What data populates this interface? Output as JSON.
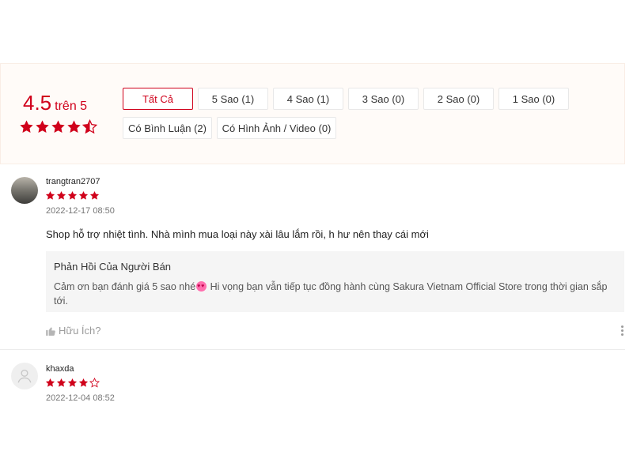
{
  "summary": {
    "score": "4.5",
    "score_suffix": "trên 5",
    "stars_rating": 4.5,
    "filters": [
      {
        "label": "Tất Cả",
        "active": true
      },
      {
        "label": "5 Sao (1)"
      },
      {
        "label": "4 Sao (1)"
      },
      {
        "label": "3 Sao (0)"
      },
      {
        "label": "2 Sao (0)"
      },
      {
        "label": "1 Sao (0)"
      },
      {
        "label": "Có Bình Luận (2)"
      },
      {
        "label": "Có Hình Ảnh / Video (0)"
      }
    ]
  },
  "reviews": [
    {
      "username": "trangtran2707",
      "rating": 5,
      "time": "2022-12-17 08:50",
      "comment": "Shop hỗ trợ nhiệt tình. Nhà mình mua loại này xài lâu lắm rồi, h hư nên thay cái mới",
      "seller_reply": {
        "title": "Phản Hồi Của Người Bán",
        "text_before_emoji": "Cảm ơn bạn đánh giá 5 sao nhé",
        "text_after_emoji": " Hi vọng bạn vẫn tiếp tục đồng hành cùng Sakura Vietnam Official Store trong thời gian sắp tới."
      },
      "helpful_label": "Hữu Ích?"
    },
    {
      "username": "khaxda",
      "rating": 4,
      "time": "2022-12-04 08:52"
    }
  ],
  "colors": {
    "accent": "#d0011b",
    "summary_bg": "#fffbf8",
    "reply_bg": "#f5f5f5"
  },
  "icons": {
    "star_full": "star-icon",
    "star_half": "star-half-icon",
    "star_empty": "star-outline-icon",
    "thumbs_up": "thumbs-up-icon",
    "more": "more-vertical-icon",
    "avatar_default": "user-icon"
  }
}
